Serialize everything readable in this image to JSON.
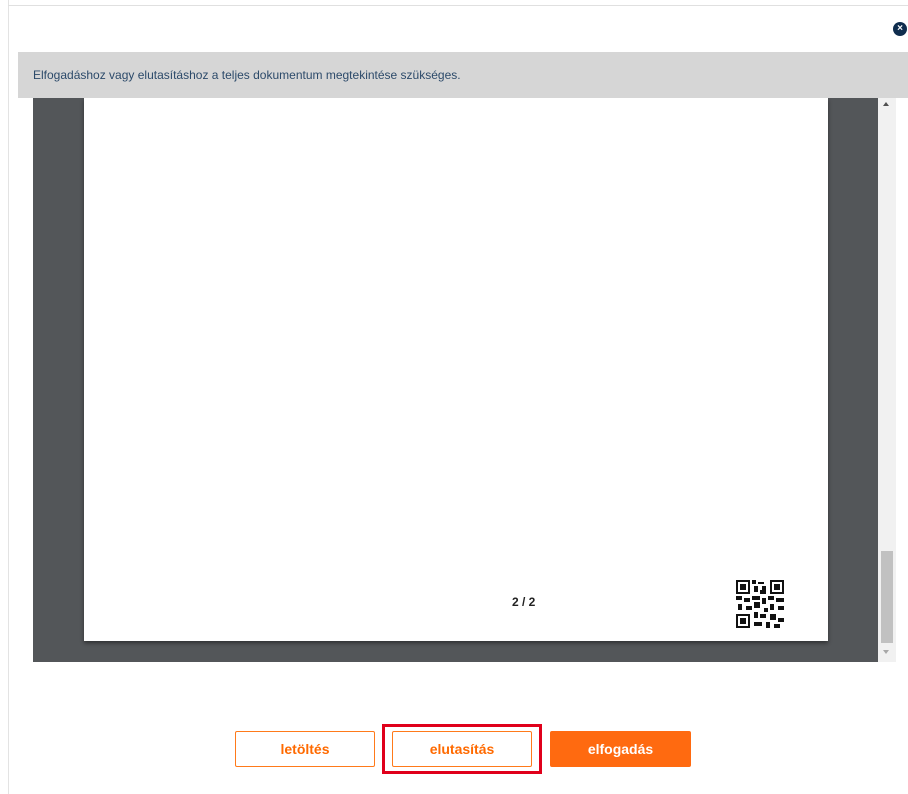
{
  "dialog": {
    "close_label": "×",
    "notice": "Elfogadáshoz vagy elutasításhoz a teljes dokumentum megtekintése szükséges."
  },
  "viewer": {
    "page_indicator": "2 / 2"
  },
  "actions": {
    "download_label": "letöltés",
    "reject_label": "elutasítás",
    "accept_label": "elfogadás"
  },
  "colors": {
    "accent": "#ff6a10",
    "highlight": "#e0001b",
    "viewer_bg": "#535659",
    "notice_bg": "#d6d6d6"
  }
}
